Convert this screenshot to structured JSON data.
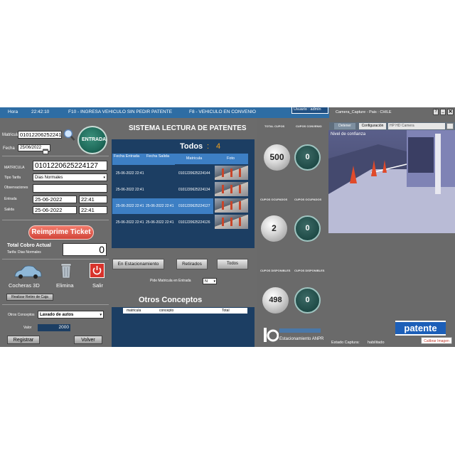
{
  "topbar": {
    "hora_label": "Hora",
    "hora_value": "22:42:10",
    "f10_text": "F10 - INGRESA VEHICULO SIN PEDIR PATENTE",
    "f8_text": "F8 - VEHICULO EN CONVENIO",
    "user_text": "Usuario : admin"
  },
  "left": {
    "matricula_label": "Matricula",
    "matricula_value": "0101220625224127",
    "entrada_button": "ENTRADA",
    "fecha_label": "Fecha",
    "fecha_value": "25/06/2022",
    "matricula2_label": "MATRICULA",
    "matricula2_value": "0101220625224127",
    "tipo_tarifa_label": "Tipo Tarifa",
    "tipo_tarifa_value": "Dias Normales",
    "observaciones_label": "Observaciones",
    "entrada_label": "Entrada",
    "entrada_date": "25-06-2022",
    "entrada_time": "22:41",
    "salida_label": "Salida",
    "salida_date": "25-06-2022",
    "salida_time": "22:41",
    "reimprime_button": "Reimprime Ticket",
    "total_cobro_label": "Total Cobro Actual",
    "tarifa_text": "Tarifa: Dias Normales",
    "total_value": "0",
    "cocheras_label": "Cocheras 3D",
    "elimina_label": "Elimina",
    "salir_label": "Salir",
    "retiro_caja_button": "Realizar Retiro de Caja",
    "otros_conceptos_label": "Otros Conceptos",
    "otros_conceptos_value": "Lavado de autos",
    "valor_label": "Valor",
    "valor_value": "2000",
    "registrar_button": "Registrar",
    "volver_button": "Volver"
  },
  "center": {
    "title": "SISTEMA LECTURA DE PATENTES",
    "todos_label": "Todos",
    "todos_sep": ":",
    "todos_count": "4",
    "columns": [
      "Fecha Entrada",
      "Fecha Salida",
      "Matricula",
      "Foto"
    ],
    "rows": [
      {
        "entrada": "25-06-2022 22:41",
        "salida": "",
        "matricula": "0101220625224144"
      },
      {
        "entrada": "25-06-2022 22:41",
        "salida": "",
        "matricula": "0101220625224134"
      },
      {
        "entrada": "25-06-2022 22:41",
        "salida": "25-06-2022 22:41",
        "matricula": "0101220625224127"
      },
      {
        "entrada": "25-06-2022 22:41",
        "salida": "25-06-2022 22:41",
        "matricula": "0101220625224126"
      }
    ],
    "btn_estacionamiento": "En Estacionamiento",
    "btn_retirados": "Retirados",
    "btn_todos": "Todos",
    "pide_matricula_label": "Pide Matricula en Entrada",
    "pide_matricula_value": "N",
    "otros_title": "Otros Conceptos",
    "otros_columns": [
      "matricula",
      "concepto",
      "Total"
    ],
    "logo_text": "Estacionamiento ANPR"
  },
  "stats": {
    "total_cupos_label": "TOTAL CUPOS",
    "cupos_convenio_label": "CUPOS CONVENIO",
    "total_cupos_value": "500",
    "cupos_convenio_value": "0",
    "ocupados_label": "CUPOS OCUPADOS",
    "ocupados_conv_label": "CUPOS OCUPADOS",
    "ocupados_value": "2",
    "ocupados_conv_value": "0",
    "disponibles_label": "CUPOS DISPONIBLES",
    "disponibles_conv_label": "CUPOS DISPONIBLES",
    "disponibles_value": "498",
    "disponibles_conv_value": "0"
  },
  "camera": {
    "title": "Camera_Capture - Pais : CHILE",
    "btn_detener": "Detener",
    "btn_config": "Configuración",
    "camera_select": "HP HD Camera",
    "nivel_label": "Nivel de confianza",
    "patente_logo": "patente",
    "estado_label": "Estado Captura:",
    "estado_value": "habilitado",
    "calibrar_button": "Calibrar Imagen"
  },
  "colors": {
    "topbar": "#2e6da4",
    "panel": "#6b6b6b",
    "entrada_button": "#1f6b5b",
    "reimprime_button": "#e05a4a",
    "table_bg": "#1c3e63",
    "patente_logo": "#1d5fb8"
  }
}
